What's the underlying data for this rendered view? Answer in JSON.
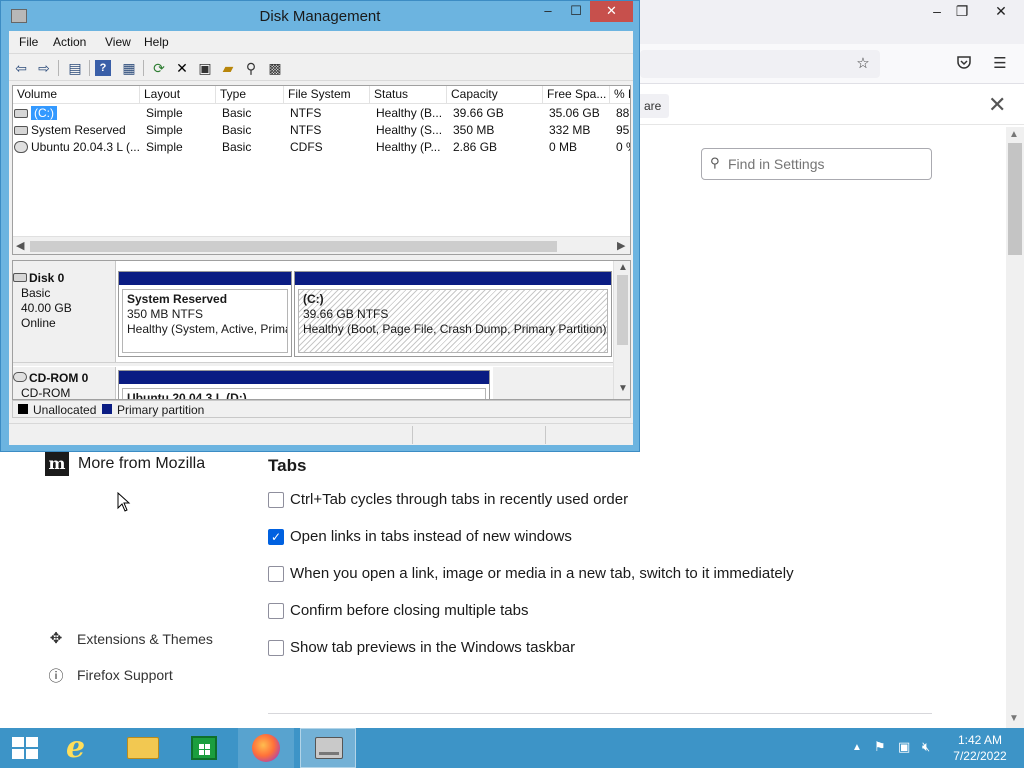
{
  "firefox": {
    "window_controls": {
      "minimize": "–",
      "maximize": "❐",
      "close": "✕"
    },
    "notification_button": "are",
    "find_placeholder": "Find in Settings",
    "more_from_mozilla": "More from Mozilla",
    "sidebar_links": [
      {
        "label": "Extensions & Themes"
      },
      {
        "label": "Firefox Support"
      }
    ],
    "tabs_section": {
      "heading": "Tabs",
      "options": [
        {
          "label": "Ctrl+Tab cycles through tabs in recently used order",
          "checked": false
        },
        {
          "label": "Open links in tabs instead of new windows",
          "checked": true
        },
        {
          "label": "When you open a link, image or media in a new tab, switch to it immediately",
          "checked": false
        },
        {
          "label": "Confirm before closing multiple tabs",
          "checked": false
        },
        {
          "label": "Show tab previews in the Windows taskbar",
          "checked": false
        }
      ]
    }
  },
  "disk_management": {
    "title": "Disk Management",
    "window_controls": {
      "minimize": "–",
      "maximize": "☐",
      "close": "✕"
    },
    "menu": [
      "File",
      "Action",
      "View",
      "Help"
    ],
    "columns": [
      "Volume",
      "Layout",
      "Type",
      "File System",
      "Status",
      "Capacity",
      "Free Spa...",
      "% F"
    ],
    "volumes": [
      {
        "volume": "(C:)",
        "layout": "Simple",
        "type": "Basic",
        "fs": "NTFS",
        "status": "Healthy (B...",
        "capacity": "39.66 GB",
        "free": "35.06 GB",
        "pct": "88"
      },
      {
        "volume": "System Reserved",
        "layout": "Simple",
        "type": "Basic",
        "fs": "NTFS",
        "status": "Healthy (S...",
        "capacity": "350 MB",
        "free": "332 MB",
        "pct": "95"
      },
      {
        "volume": "Ubuntu 20.04.3 L (...",
        "layout": "Simple",
        "type": "Basic",
        "fs": "CDFS",
        "status": "Healthy (P...",
        "capacity": "2.86 GB",
        "free": "0 MB",
        "pct": "0 %"
      }
    ],
    "disks": [
      {
        "name": "Disk 0",
        "kind": "Basic",
        "size": "40.00 GB",
        "state": "Online",
        "partitions": [
          {
            "name": "System Reserved",
            "size_fs": "350 MB NTFS",
            "status": "Healthy (System, Active, Primary Partition)"
          },
          {
            "name": "(C:)",
            "size_fs": "39.66 GB NTFS",
            "status": "Healthy (Boot, Page File, Crash Dump, Primary Partition)"
          }
        ]
      },
      {
        "name": "CD-ROM 0",
        "kind": "CD-ROM",
        "partitions": [
          {
            "name": "Ubuntu 20.04.3 L (D:)"
          }
        ]
      }
    ],
    "legend": [
      {
        "label": "Unallocated",
        "color": "#000000"
      },
      {
        "label": "Primary partition",
        "color": "#0a1c83"
      }
    ]
  },
  "taskbar": {
    "apps": [
      "start",
      "internet-explorer",
      "file-explorer",
      "store",
      "firefox",
      "disk-management"
    ],
    "clock": {
      "time": "1:42 AM",
      "date": "7/22/2022"
    }
  }
}
